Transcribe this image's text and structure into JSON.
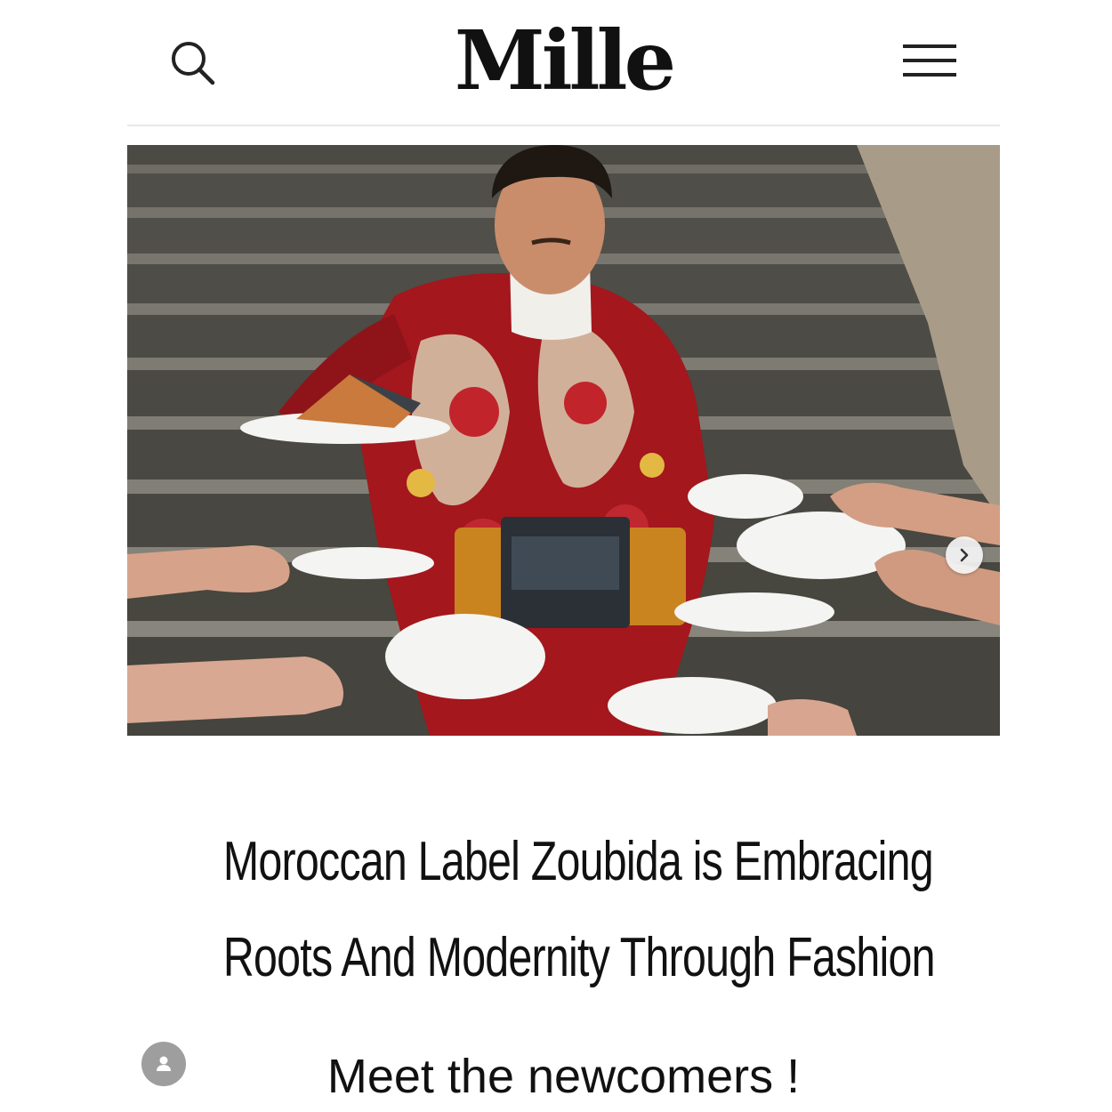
{
  "header": {
    "logo": "Mille",
    "search_icon": "search-icon",
    "menu_icon": "hamburger-menu-icon"
  },
  "hero": {
    "image_alt": "photo",
    "next_icon": "chevron-right-icon",
    "colors": {
      "jacket_red": "#a3171d",
      "stairs": "#5b5a55",
      "plate": "#f4f4f2"
    }
  },
  "article": {
    "headline_line1": "Moroccan Label Zoubida is Embracing",
    "headline_line2": "Roots And Modernity Through Fashion",
    "subheading": "Meet the newcomers !",
    "author_icon": "user-avatar-icon"
  }
}
